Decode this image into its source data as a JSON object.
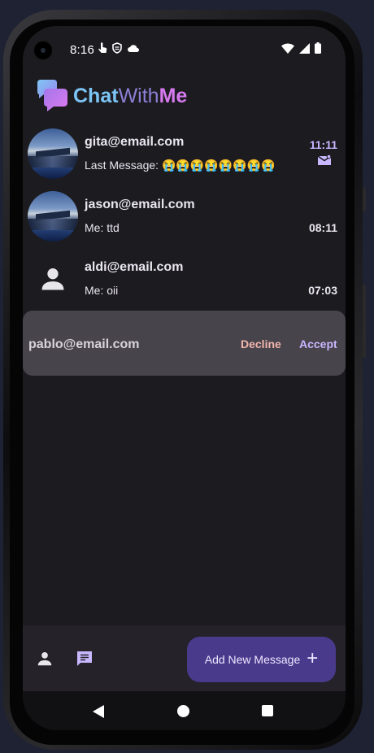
{
  "status_bar": {
    "time": "8:16",
    "left_icons": [
      "touch-icon",
      "shield-icon",
      "cloud-icon"
    ],
    "right_icons": [
      "wifi-icon",
      "signal-icon",
      "battery-icon"
    ]
  },
  "header": {
    "logo_part1": "Chat",
    "logo_part2": "With",
    "logo_part3": "Me"
  },
  "chats": [
    {
      "name": "gita@email.com",
      "message": "Last Message: 😭😭😭😭😭😭😭😭",
      "time": "11:11",
      "unread": true,
      "avatar": "photo"
    },
    {
      "name": "jason@email.com",
      "message": "Me: ttd",
      "time": "08:11",
      "unread": false,
      "avatar": "photo"
    },
    {
      "name": "aldi@email.com",
      "message": "Me: oii",
      "time": "07:03",
      "unread": false,
      "avatar": "person-icon"
    }
  ],
  "request": {
    "email": "pablo@email.com",
    "decline_label": "Decline",
    "accept_label": "Accept"
  },
  "bottom_bar": {
    "fab_label": "Add New Message",
    "fab_icon": "plus-icon",
    "nav_icons": [
      "person-icon",
      "chat-icon"
    ]
  },
  "colors": {
    "background": "#1c1b20",
    "accent": "#c8b7ff",
    "fab": "#4a3a8c",
    "decline": "#f2b6ad",
    "request_card": "#48444c"
  }
}
